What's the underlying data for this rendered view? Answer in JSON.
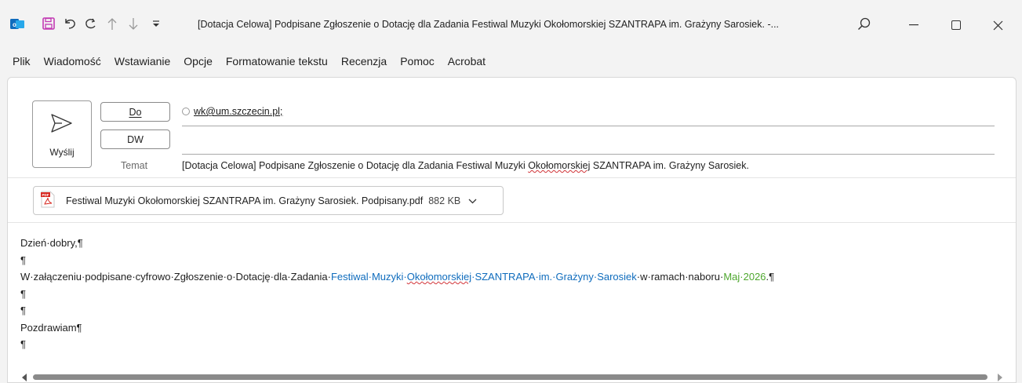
{
  "titlebar": {
    "title": "[Dotacja Celowa] Podpisane Zgłoszenie o Dotację dla Zadania Festiwal Muzyki Okołomorskiej SZANTRAPA im. Grażyny Sarosiek.  -...",
    "app_icon": "outlook-icon",
    "accent": "#0f6cbd",
    "save_color": "#c239b3"
  },
  "menu": {
    "items": [
      "Plik",
      "Wiadomość",
      "Wstawianie",
      "Opcje",
      "Formatowanie tekstu",
      "Recenzja",
      "Pomoc",
      "Acrobat"
    ]
  },
  "compose": {
    "send_label": "Wyślij",
    "to_label": "Do",
    "cc_label": "DW",
    "subject_label": "Temat",
    "to_value": "wk@um.szczecin.pl;",
    "cc_value": "",
    "subject_pre": "[Dotacja Celowa] Podpisane Zgłoszenie o Dotację dla Zadania Festiwal Muzyki ",
    "subject_mis": "Okołomorskiej",
    "subject_post": " SZANTRAPA im. Grażyny Sarosiek."
  },
  "attachment": {
    "name": "Festiwal Muzyki Okołomorskiej SZANTRAPA im. Grażyny Sarosiek. Podpisany.pdf",
    "size": "882 KB"
  },
  "body": {
    "greeting": "Dzień·dobry,¶",
    "pilcrow": "¶",
    "line3_pre": "W·załączeniu·podpisane·cyfrowo·Zgłoszenie·o·Dotację·dla·Zadania·",
    "line3_link1": "Festiwal·Muzyki·",
    "line3_link_mis": "Okołomorskiej",
    "line3_link2": "·SZANTRAPA·im.·Grażyny·Sarosiek",
    "line3_mid": "·w·ramach·naboru·",
    "line3_date": "Maj·2026",
    "line3_end": ".¶",
    "closing": "Pozdrawiam¶"
  }
}
